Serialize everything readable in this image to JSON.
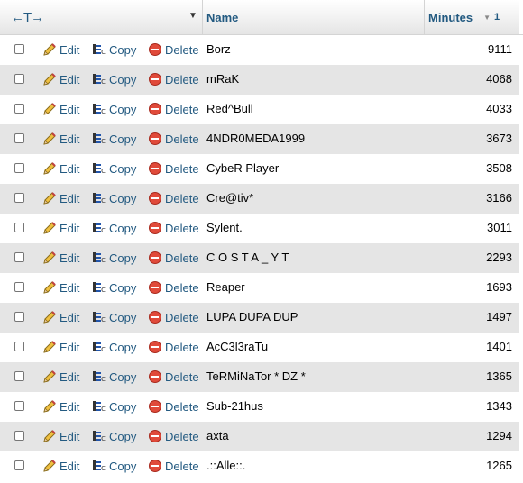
{
  "header": {
    "arrows": "←T→",
    "sort_triangle": "▼",
    "name_label": "Name",
    "minutes_label": "Minutes",
    "sort_icon": "▼",
    "sort_index": "1"
  },
  "actions": {
    "edit": "Edit",
    "copy": "Copy",
    "delete": "Delete"
  },
  "rows": [
    {
      "name": "Borz",
      "minutes": "9111"
    },
    {
      "name": "mRaK",
      "minutes": "4068"
    },
    {
      "name": "Red^Bull",
      "minutes": "4033"
    },
    {
      "name": "4NDR0MEDA1999",
      "minutes": "3673"
    },
    {
      "name": "CybeR Player",
      "minutes": "3508"
    },
    {
      "name": "Cre@tiv*",
      "minutes": "3166"
    },
    {
      "name": "Sylent.",
      "minutes": "3011"
    },
    {
      "name": "C O S T A _ Y T",
      "minutes": "2293"
    },
    {
      "name": "Reaper",
      "minutes": "1693"
    },
    {
      "name": "LUPA DUPA DUP",
      "minutes": "1497"
    },
    {
      "name": "AcC3l3raTu",
      "minutes": "1401"
    },
    {
      "name": "TeRMiNaTor * DZ *",
      "minutes": "1365"
    },
    {
      "name": "Sub-21hus",
      "minutes": "1343"
    },
    {
      "name": "axta",
      "minutes": "1294"
    },
    {
      "name": ".::Alle::.",
      "minutes": "1265"
    }
  ],
  "icons": {
    "edit": "pencil-icon",
    "copy": "copy-icon",
    "delete": "delete-icon"
  }
}
